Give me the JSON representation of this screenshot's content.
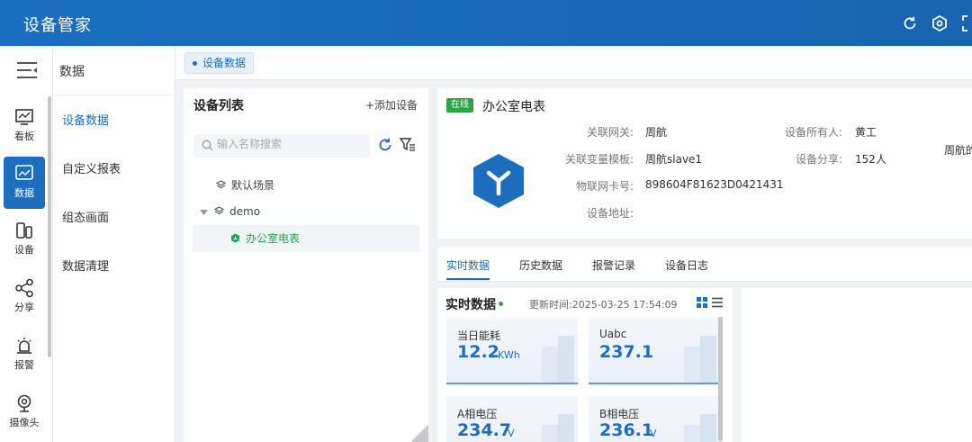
{
  "header": {
    "app_title": "设备管家"
  },
  "rail": {
    "items": [
      {
        "label": "看板",
        "icon": "dashboard-icon"
      },
      {
        "label": "数据",
        "icon": "chart-icon",
        "active": true
      },
      {
        "label": "设备",
        "icon": "device-icon"
      },
      {
        "label": "分享",
        "icon": "share-icon"
      },
      {
        "label": "报警",
        "icon": "alarm-icon"
      },
      {
        "label": "摄像头",
        "icon": "camera-icon"
      }
    ]
  },
  "subnav": {
    "title": "数据",
    "items": [
      {
        "label": "设备数据",
        "active": true
      },
      {
        "label": "自定义报表"
      },
      {
        "label": "组态画面"
      },
      {
        "label": "数据清理"
      }
    ]
  },
  "breadcrumb": {
    "tag": "设备数据"
  },
  "device_list": {
    "title": "设备列表",
    "add_label": "+添加设备",
    "search_placeholder": "输入名称搜索",
    "tree": [
      {
        "label": "默认场景",
        "icon": "layers-icon"
      },
      {
        "label": "demo",
        "icon": "layers-icon",
        "expanded": true
      },
      {
        "label": "办公室电表",
        "icon": "device-node-icon",
        "selected": true
      }
    ]
  },
  "device_info": {
    "status": "在线",
    "name": "办公室电表",
    "gateway_label": "关联网关:",
    "gateway_value": "周航",
    "template_label": "关联变量模板:",
    "template_value": "周航slave1",
    "sim_label": "物联网卡号:",
    "sim_value": "898604F81623D0421431",
    "address_label": "设备地址:",
    "address_value": "",
    "owner_label": "设备所有人:",
    "owner_value": "黄工",
    "share_label": "设备分享:",
    "share_value": "152人",
    "extra_value": "周航的"
  },
  "data_tabs": [
    {
      "label": "实时数据",
      "active": true
    },
    {
      "label": "历史数据"
    },
    {
      "label": "报警记录"
    },
    {
      "label": "设备日志"
    }
  ],
  "realtime": {
    "title": "实时数据",
    "update_label": "更新时间:",
    "update_time": "2025-03-25 17:54:09",
    "metrics": [
      {
        "label": "当日能耗",
        "value": "12.2",
        "unit": "KWh"
      },
      {
        "label": "Uabc",
        "value": "237.1",
        "unit": ""
      },
      {
        "label": "A相电压",
        "value": "234.7",
        "unit": "V"
      },
      {
        "label": "B相电压",
        "value": "236.1",
        "unit": "V"
      }
    ]
  },
  "colors": {
    "primary": "#1d6ebd",
    "online": "#2fa344",
    "header_bg": "#1b6fc0"
  }
}
